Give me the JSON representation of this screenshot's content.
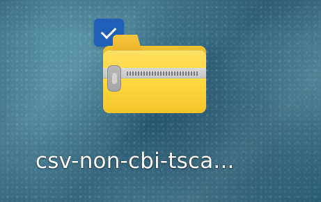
{
  "desktop": {
    "item": {
      "label": "csv-non-cbi-tsca...",
      "icon": "zip-folder-icon",
      "selected": true,
      "selection_icon": "checkbox-check-icon"
    }
  },
  "colors": {
    "selection_blue": "#1f5fb8",
    "folder_yellow": "#ffd63c",
    "zipper_gray": "#c9c9c9"
  }
}
